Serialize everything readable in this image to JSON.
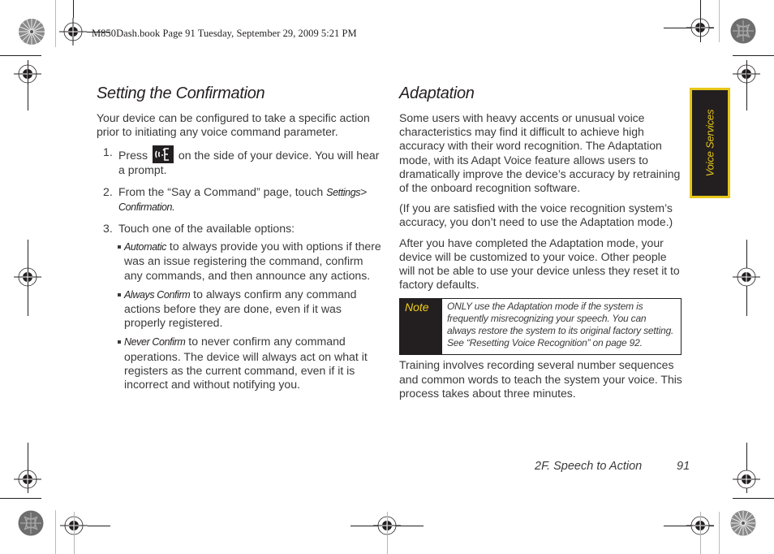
{
  "slug": {
    "text": "M850Dash.book  Page 91  Tuesday, September 29, 2009  5:21 PM"
  },
  "left_column": {
    "heading": "Setting the Confirmation",
    "intro": "Your device can be configured to take a specific action prior to initiating any voice command parameter.",
    "steps": [
      {
        "number": "1.",
        "before_icon": "Press",
        "icon": "voice-command-key-icon",
        "after_icon": "on the side of your device. You will hear a prompt."
      },
      {
        "number": "2.",
        "text": "From the “Say a Command” page, touch",
        "ui_term": "Settings",
        "separator": ">",
        "ui_term_2": "Confirmation",
        "end": "."
      },
      {
        "number": "3.",
        "text": "Touch one of the available options:"
      }
    ],
    "options": [
      {
        "term": "Automatic",
        "description": " to always provide you with options if there was an issue registering the command, confirm any commands, and then announce any actions."
      },
      {
        "term": "Always Confirm",
        "description": " to always confirm any command actions before they are done, even if it was properly registered."
      },
      {
        "term": "Never Confirm",
        "description": " to never confirm any command operations. The device will always act on what it registers as the current command, even if it is incorrect and without notifying you."
      }
    ]
  },
  "right_column": {
    "heading": "Adaptation",
    "paragraphs": [
      "Some users with heavy accents or unusual voice characteristics may find it difficult to achieve high accuracy with their word recognition. The Adaptation mode, with its Adapt Voice feature allows users to dramatically improve the device’s accuracy by retraining of the onboard recognition software.",
      "(If you are satisfied with the voice recognition system’s accuracy, you don’t need to use the Adaptation mode.)",
      "After you have completed the Adaptation mode, your device will be customized to your voice. Other people will not be able to use your device unless they reset it to factory defaults."
    ],
    "note": {
      "label": "Note",
      "text": "ONLY use the Adaptation mode if the system is frequently misrecognizing your speech. You can always restore the system to its original factory setting. See “Resetting Voice Recognition” on page 92."
    },
    "closing": "Training involves recording several number sequences and common words to teach the system your voice. This process takes about three minutes."
  },
  "side_tab": {
    "label": "Voice Services"
  },
  "footer": {
    "section": "2F. Speech to Action",
    "page_number": "91"
  },
  "colors": {
    "accent_yellow": "#e6c619",
    "dark": "#231f20",
    "body_text": "#3a3a3a"
  }
}
